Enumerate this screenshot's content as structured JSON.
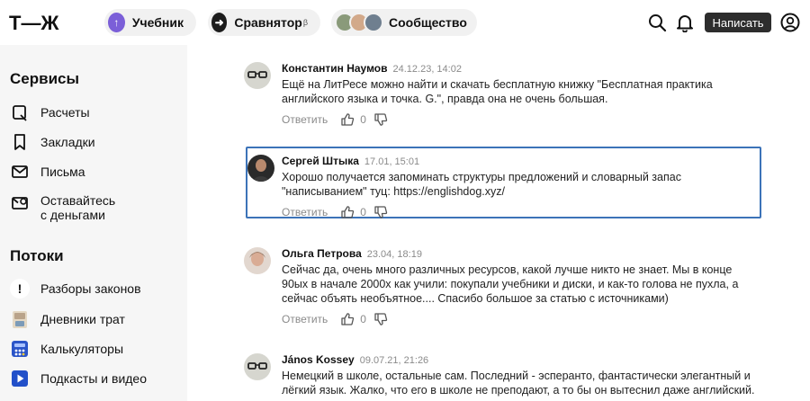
{
  "header": {
    "logo_text": "Т—Ж",
    "nav": [
      {
        "label": "Учебник",
        "icon": "arrow-up-icon",
        "color": "#7b5fd8"
      },
      {
        "label": "Сравнятор",
        "suffix": "β",
        "icon": "arrow-right-icon",
        "color": "#1c1c1c"
      },
      {
        "label": "Сообщество",
        "icon": "avatars-icon"
      }
    ],
    "write_label": "Написать"
  },
  "sidebar": {
    "services_title": "Сервисы",
    "services": [
      {
        "label": "Расчеты",
        "icon": "calculation-icon"
      },
      {
        "label": "Закладки",
        "icon": "bookmark-icon"
      },
      {
        "label": "Письма",
        "icon": "mail-icon"
      },
      {
        "label_1": "Оставайтесь",
        "label_2": "с деньгами",
        "icon": "money-mail-icon"
      }
    ],
    "streams_title": "Потоки",
    "streams": [
      {
        "label": "Разборы законов",
        "icon": "exclamation-icon"
      },
      {
        "label": "Дневники трат",
        "icon": "diary-icon"
      },
      {
        "label": "Калькуляторы",
        "icon": "calculator-icon"
      },
      {
        "label": "Подкасты и видео",
        "icon": "play-icon"
      }
    ]
  },
  "comments": [
    {
      "author": "Константин Наумов",
      "date": "24.12.23, 14:02",
      "text": "Ещё на ЛитРесе можно найти и скачать бесплатную книжку \"Бесплатная практика английского языка и точка. G.\", правда она не очень большая.",
      "reply": "Ответить",
      "likes": "0"
    },
    {
      "author": "Сергей Штыка",
      "date": "17.01, 15:01",
      "text": "Хорошо получается запоминать структуры предложений и словарный запас \"написыванием\" туц: https://englishdog.xyz/",
      "reply": "Ответить",
      "likes": "0"
    },
    {
      "author": "Ольга Петрова",
      "date": "23.04, 18:19",
      "text": "Сейчас да, очень много различных ресурсов, какой лучше никто не знает. Мы в конце 90ых в начале 2000х как учили: покупали учебники и диски, и как-то голова не пухла, а сейчас объять необъятное.... Спасибо большое за статью с источниками)",
      "reply": "Ответить",
      "likes": "0"
    },
    {
      "author": "János Kossey",
      "date": "09.07.21, 21:26",
      "text": "Немецкий в школе, остальные сам. Последний - эсперанто, фантастически элегантный и лёгкий язык. Жалко, что его в школе не преподают, а то бы он вытеснил даже английский.",
      "reply": "Ответить",
      "likes": "0"
    }
  ],
  "colors": {
    "accent": "#3c73b8",
    "sidebar_bg": "#f6f6f6",
    "button_dark": "#2d2d2d"
  }
}
